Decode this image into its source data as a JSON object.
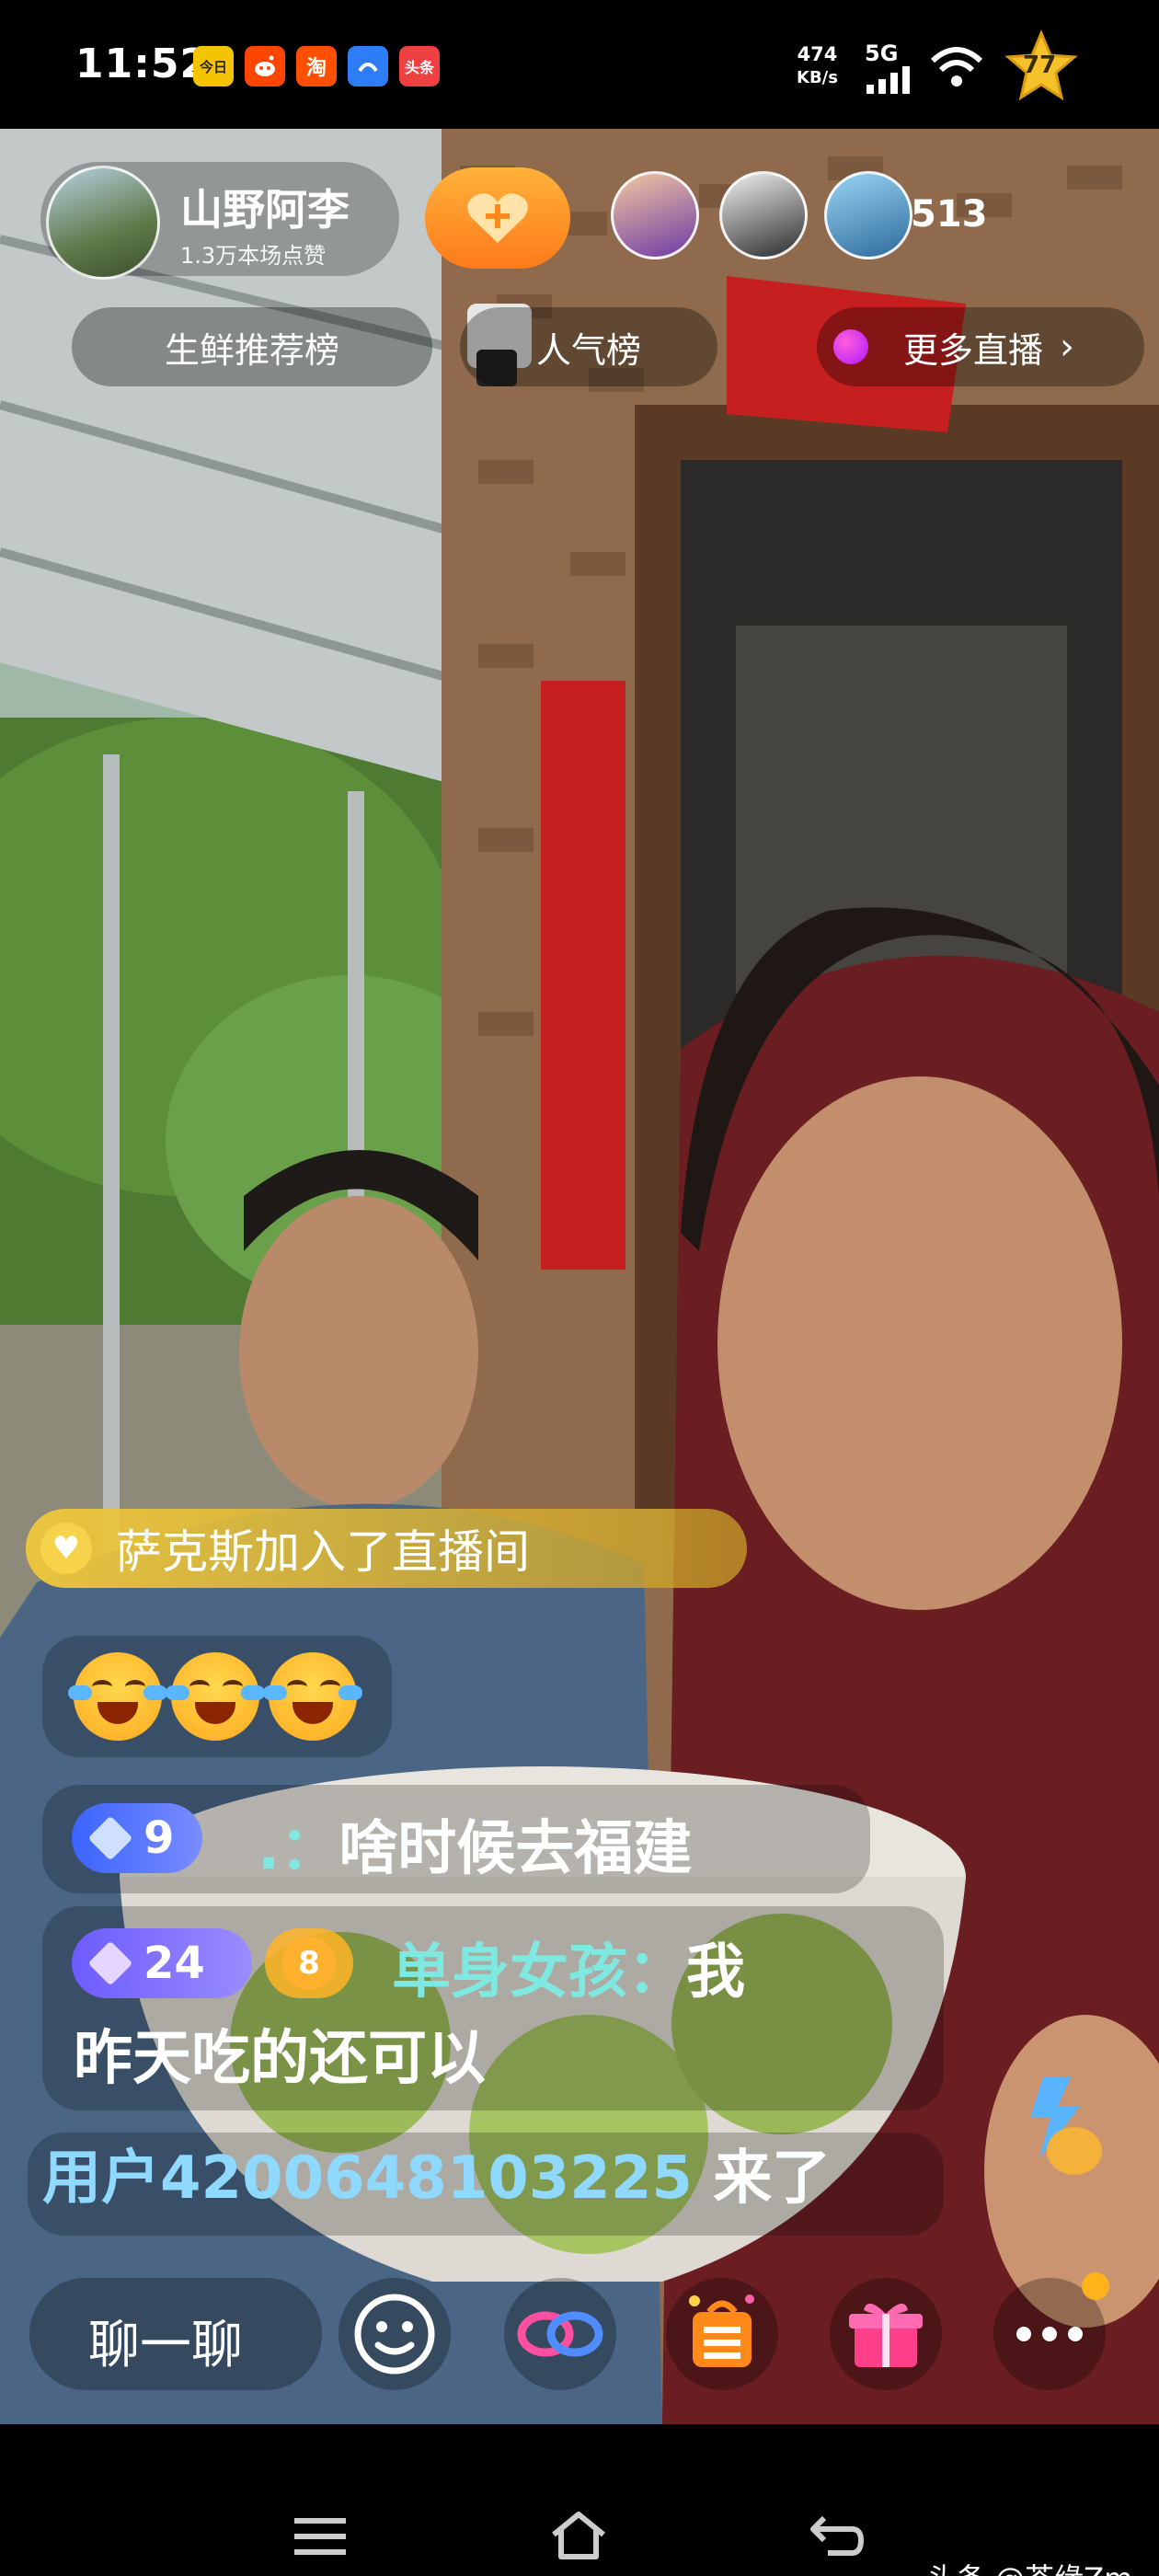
{
  "status_bar": {
    "time": "11:52",
    "apps": [
      {
        "icon": "jinri-app-icon",
        "label": "今日",
        "color": "#f5c400"
      },
      {
        "icon": "reddit-app-icon",
        "label": "",
        "color": "#ff4500"
      },
      {
        "icon": "taobao-app-icon",
        "label": "淘",
        "color": "#ff5000"
      },
      {
        "icon": "blue-app-icon",
        "label": "",
        "color": "#2e7cf6"
      },
      {
        "icon": "toutiao-app-icon",
        "label": "头条",
        "color": "#f04142"
      }
    ],
    "net_speed": "474",
    "net_speed_unit": "KB/s",
    "network": "5G",
    "star_count": "77"
  },
  "live": {
    "host_name": "山野阿李",
    "likes": "1.3万本场点赞",
    "follow_icon": "heart-plus-icon",
    "viewer_count": "513",
    "close_icon": "close-icon",
    "rank_left": "生鲜推荐榜",
    "rank_mid": "人气榜",
    "more_live": "更多直播",
    "more_arrow": "›"
  },
  "comments": {
    "join_user": "萨克斯",
    "join_text": " 加入了直播间",
    "emojis": [
      "crying-laughing-emoji",
      "crying-laughing-emoji",
      "crying-laughing-emoji"
    ],
    "c1_level": "9",
    "c1_sep": ".：",
    "c1_text": "啥时候去福建",
    "c2_level": "24",
    "c2_fan_level": "8",
    "c2_user": "单身女孩：",
    "c2_text_line1": "我",
    "c2_text_line2": "昨天吃的还可以",
    "enter_user": "用户4200648103225",
    "enter_text": "来了"
  },
  "bottom_bar": {
    "chat_label": "聊一聊",
    "buttons": [
      "emoji-icon",
      "link-icon",
      "shop-icon",
      "gift-icon",
      "more-icon"
    ]
  },
  "watermark": "头条 @茶缘Zm",
  "colors": {
    "follow_orange": "#ff8a1a",
    "join_gold": "#e8c040",
    "username_cyan": "#7fe8e0",
    "level_purple": "#6e5bff"
  }
}
